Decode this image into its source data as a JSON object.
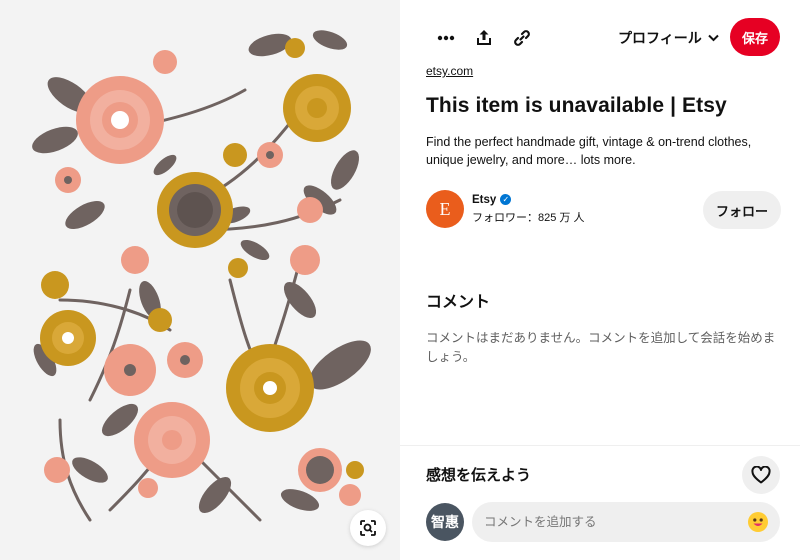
{
  "pin": {
    "source": "etsy.com",
    "title": "This item is unavailable | Etsy",
    "description": "Find the perfect handmade gift, vintage & on-trend clothes, unique jewelry, and more… lots more."
  },
  "toolbar": {
    "more_icon": "more-horizontal-icon",
    "share_icon": "share-upload-icon",
    "link_icon": "link-icon",
    "profile_label": "プロフィール",
    "save_label": "保存"
  },
  "creator": {
    "avatar_letter": "E",
    "name": "Etsy",
    "verified": true,
    "followers": "フォロワー：825 万 人",
    "follow_label": "フォロー"
  },
  "comments": {
    "title": "コメント",
    "empty_text": "コメントはまだありません。コメントを追加して会話を始めましょう。"
  },
  "feedback": {
    "title": "感想を伝えよう"
  },
  "composer": {
    "avatar_text": "智惠",
    "placeholder": "コメントを追加する"
  },
  "colors": {
    "accent": "#e60023",
    "etsy_orange": "#ea5d1c",
    "verified_blue": "#0076d3",
    "image_bg": "#f3f3f3",
    "flower_salmon": "#ee9c87",
    "flower_mustard": "#c9971f",
    "leaf_taupe": "#6f6360"
  }
}
